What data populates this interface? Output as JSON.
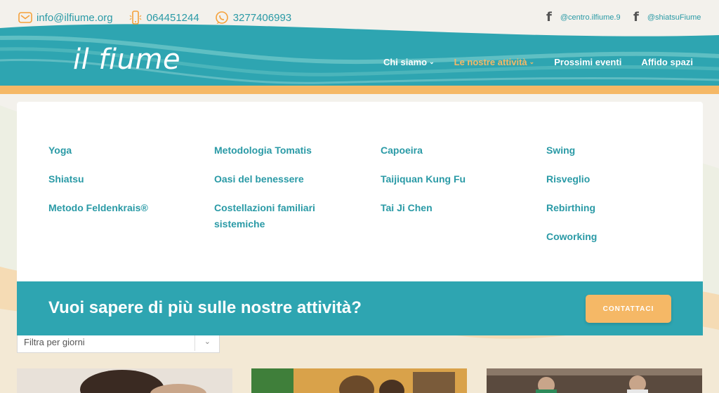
{
  "topbar": {
    "email": "info@ilfiume.org",
    "phone": "064451244",
    "whatsapp": "3277406993",
    "social": [
      {
        "icon": "facebook-icon",
        "handle": "@centro.ilfiume.9"
      },
      {
        "icon": "facebook-icon",
        "handle": "@shiatsuFiume"
      }
    ]
  },
  "brand": {
    "logo": "il fiume"
  },
  "nav": {
    "items": [
      {
        "label": "Chi siamo",
        "has_dropdown": true
      },
      {
        "label": "Le nostre attività",
        "has_dropdown": true,
        "active": true
      },
      {
        "label": "Prossimi eventi",
        "has_dropdown": false
      },
      {
        "label": "Affido spazi",
        "has_dropdown": false
      }
    ]
  },
  "mega_menu": {
    "columns": [
      [
        "Yoga",
        "Shiatsu",
        "Metodo Feldenkrais®"
      ],
      [
        "Metodologia Tomatis",
        "Oasi del benessere",
        "Costellazioni familiari sistemiche"
      ],
      [
        "Capoeira",
        "Taijiquan Kung Fu",
        "Tai Ji Chen"
      ],
      [
        "Swing",
        "Risveglio",
        "Rebirthing",
        "Coworking"
      ]
    ],
    "cta_text": "Vuoi sapere di più sulle nostre attività?",
    "cta_button": "CONTATTACI"
  },
  "filter": {
    "value": "Filtra per giorni"
  },
  "colors": {
    "teal": "#2ea5b1",
    "teal_text": "#2a9aa6",
    "orange": "#f5b866",
    "background": "#f3f1ec"
  }
}
